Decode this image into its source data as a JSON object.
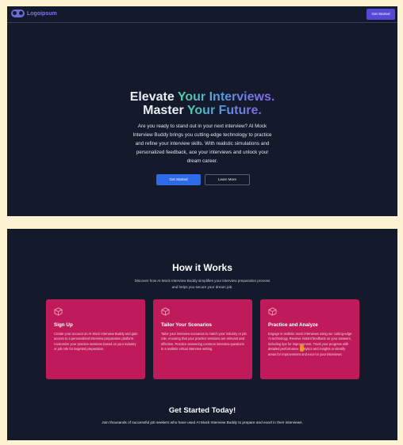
{
  "navbar": {
    "logo_text": "Logoipsum",
    "cta_label": "Get Started"
  },
  "hero": {
    "title_line1_plain": "Elevate ",
    "title_line1_highlight": "Your Interviews.",
    "title_line2_plain": "Master ",
    "title_line2_highlight": "Your Future.",
    "subtitle": "Are you ready to stand out in your next interview? AI Mock Interview Buddy brings you cutting-edge technology to practice and refine your interview skills. With realistic simulations and personalized feedback, ace your interviews and unlock your dream career.",
    "primary_button": "Get Started",
    "secondary_button": "Learn More"
  },
  "how_it_works": {
    "title": "How it Works",
    "subtitle": "Discover how AI Mock Interview Buddy simplifies your interview preparation process and helps you secure your dream job.",
    "cards": [
      {
        "icon": "cube-icon",
        "title": "Sign Up",
        "text": "Create your account on AI Mock Interview Buddy and gain access to a personalized interview preparation platform. Customize your practice sessions based on your industry or job role for targeted preparation."
      },
      {
        "icon": "cube-icon",
        "title": "Tailor Your Scenarios",
        "text": "Tailor your interview scenarios to match your industry or job role, ensuring that your practice sessions are relevant and effective. Practice answering common interview questions in a realistic virtual interview setting."
      },
      {
        "icon": "cube-icon",
        "title": "Practice and Analyze",
        "text": "Engage in realistic mock interviews using our cutting-edge AI technology. Receive instant feedback on your answers, including tips for improvement. Track your progress with detailed performance analytics and insights to identify areas for improvement and excel in your interviews."
      }
    ]
  },
  "get_started": {
    "title": "Get Started Today!",
    "subtitle": "Join thousands of successful job seekers who have used AI Mock Interview Buddy to prepare and excel in their interviews."
  },
  "colors": {
    "background": "#141a2b",
    "card": "#bf1b5b",
    "primary": "#2f6ae9",
    "nav_button": "#5747d6",
    "frame": "#fdf3d3"
  }
}
